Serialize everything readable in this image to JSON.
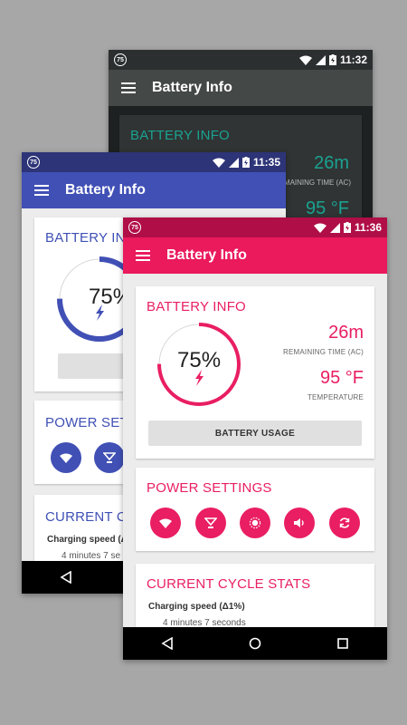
{
  "colors": {
    "dark_accent": "#1aa391",
    "blue_accent": "#4150b5",
    "pink_accent": "#e91e63"
  },
  "status": {
    "badge": "75",
    "phone1_time": "11:32",
    "phone2_time": "11:35",
    "phone3_time": "11:36"
  },
  "app": {
    "title": "Battery Info"
  },
  "battery": {
    "section_title": "BATTERY INFO",
    "percent_text": "75%",
    "level": 0.75,
    "remaining_value": "26m",
    "remaining_label": "REMAINING TIME (AC)",
    "remaining_label_cropped": "MAINING TIME (AC)",
    "temperature_value": "95 °F",
    "temperature_label": "TEMPERATURE",
    "usage_button": "BATTERY USAGE",
    "usage_button_cropped": "B"
  },
  "power": {
    "section_title": "POWER SETTINGS",
    "section_title_cropped": "POWER SETTIN",
    "buttons": [
      "wifi-icon",
      "hotspot-icon",
      "brightness-icon",
      "volume-icon",
      "sync-icon"
    ]
  },
  "cycle": {
    "section_title": "CURRENT CYCLE STATS",
    "section_title_cropped": "CURRENT CYC",
    "charging_label": "Charging speed (Δ1%)",
    "charging_label_cropped": "Charging speed (Δ",
    "charging_value": "4 minutes 7 seconds",
    "charging_value_cropped": "4 minutes 7 se"
  },
  "nav": [
    "back-icon",
    "home-icon",
    "recents-icon"
  ]
}
